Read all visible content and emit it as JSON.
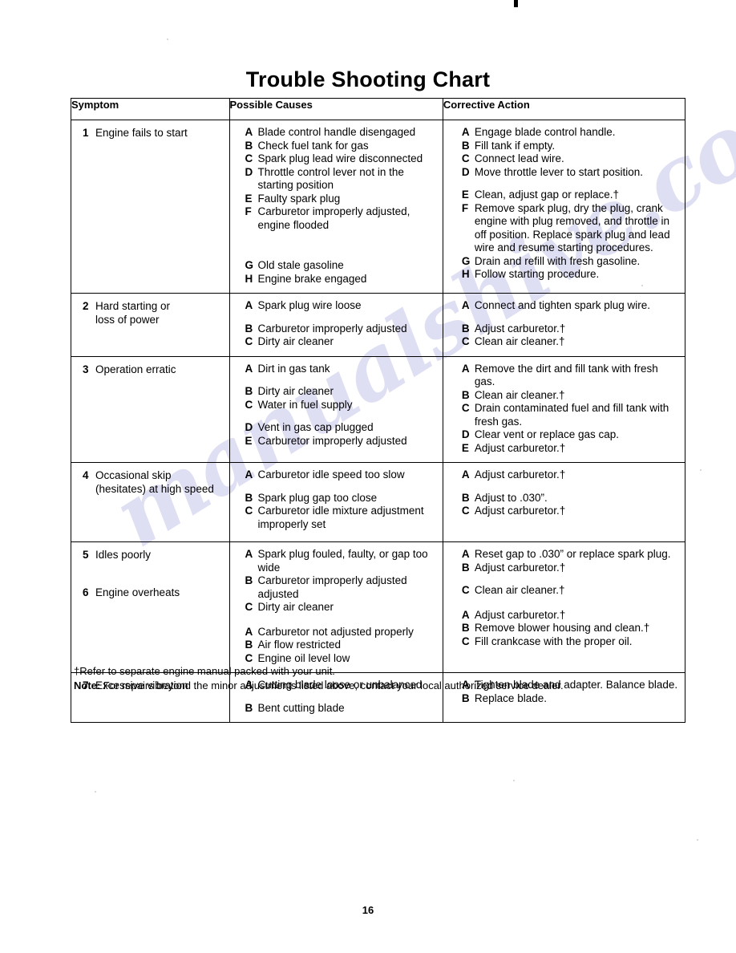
{
  "document": {
    "title": "Trouble Shooting Chart",
    "page_number": "16",
    "watermark": "manualshive.com"
  },
  "table": {
    "headers": {
      "symptom": "Symptom",
      "possible_causes": "Possible Causes",
      "corrective_action": "Corrective Action"
    },
    "rows": [
      {
        "number": "1",
        "symptom": "Engine fails to start",
        "symptom_line2": "",
        "causes": [
          {
            "letter": "A",
            "text": "Blade control handle disengaged"
          },
          {
            "letter": "B",
            "text": "Check fuel tank for gas"
          },
          {
            "letter": "C",
            "text": "Spark plug lead wire disconnected"
          },
          {
            "letter": "D",
            "text": "Throttle control lever not in the starting position"
          },
          {
            "letter": "E",
            "text": "Faulty spark plug"
          },
          {
            "letter": "F",
            "text": "Carburetor improperly adjusted, engine flooded"
          },
          {
            "letter": "G",
            "text": "Old stale gasoline"
          },
          {
            "letter": "H",
            "text": "Engine brake engaged"
          }
        ],
        "actions": [
          {
            "letter": "A",
            "text": "Engage blade control handle."
          },
          {
            "letter": "B",
            "text": "Fill tank if empty."
          },
          {
            "letter": "C",
            "text": "Connect lead wire."
          },
          {
            "letter": "D",
            "text": "Move throttle lever to start position."
          },
          {
            "letter": "E",
            "text": "Clean, adjust gap or replace.†"
          },
          {
            "letter": "F",
            "text": "Remove spark plug, dry the plug, crank engine with plug removed, and throttle in off position. Replace spark plug and lead wire and resume starting procedures."
          },
          {
            "letter": "G",
            "text": "Drain and refill with fresh gasoline."
          },
          {
            "letter": "H",
            "text": "Follow starting procedure."
          }
        ]
      },
      {
        "number": "2",
        "symptom": "Hard starting or",
        "symptom_line2": "loss of power",
        "causes": [
          {
            "letter": "A",
            "text": "Spark plug wire loose"
          },
          {
            "letter": "B",
            "text": "Carburetor improperly adjusted"
          },
          {
            "letter": "C",
            "text": "Dirty air cleaner"
          }
        ],
        "actions": [
          {
            "letter": "A",
            "text": "Connect and tighten spark plug wire."
          },
          {
            "letter": "B",
            "text": "Adjust carburetor.†"
          },
          {
            "letter": "C",
            "text": "Clean air cleaner.†"
          }
        ]
      },
      {
        "number": "3",
        "symptom": "Operation erratic",
        "symptom_line2": "",
        "causes": [
          {
            "letter": "A",
            "text": "Dirt in gas tank"
          },
          {
            "letter": "B",
            "text": "Dirty air cleaner"
          },
          {
            "letter": "C",
            "text": "Water in fuel supply"
          },
          {
            "letter": "D",
            "text": "Vent in gas cap plugged"
          },
          {
            "letter": "E",
            "text": "Carburetor improperly adjusted"
          }
        ],
        "actions": [
          {
            "letter": "A",
            "text": "Remove the dirt and fill tank with fresh gas."
          },
          {
            "letter": "B",
            "text": "Clean air cleaner.†"
          },
          {
            "letter": "C",
            "text": "Drain contaminated fuel and fill tank with fresh gas."
          },
          {
            "letter": "D",
            "text": "Clear vent or replace gas cap."
          },
          {
            "letter": "E",
            "text": "Adjust carburetor.†"
          }
        ]
      },
      {
        "number": "4",
        "symptom": "Occasional skip",
        "symptom_line2": "(hesitates) at high speed",
        "causes": [
          {
            "letter": "A",
            "text": "Carburetor idle speed too slow"
          },
          {
            "letter": "B",
            "text": "Spark plug gap too close"
          },
          {
            "letter": "C",
            "text": "Carburetor idle mixture adjustment improperly set"
          }
        ],
        "actions": [
          {
            "letter": "A",
            "text": "Adjust carburetor.†"
          },
          {
            "letter": "B",
            "text": "Adjust to .030”."
          },
          {
            "letter": "C",
            "text": "Adjust carburetor.†"
          }
        ]
      },
      {
        "number": "5",
        "symptom": "Idles poorly",
        "symptom_line2": "",
        "causes": [
          {
            "letter": "A",
            "text": "Spark plug fouled, faulty, or gap too wide"
          },
          {
            "letter": "B",
            "text": "Carburetor improperly adjusted adjusted"
          },
          {
            "letter": "C",
            "text": "Dirty air cleaner"
          }
        ],
        "actions": [
          {
            "letter": "A",
            "text": "Reset gap to .030” or replace spark plug."
          },
          {
            "letter": "B",
            "text": "Adjust carburetor.†"
          },
          {
            "letter": "C",
            "text": "Clean air cleaner.†"
          }
        ]
      },
      {
        "number": "6",
        "symptom": "Engine overheats",
        "symptom_line2": "",
        "causes": [
          {
            "letter": "A",
            "text": "Carburetor not adjusted properly"
          },
          {
            "letter": "B",
            "text": "Air flow restricted"
          },
          {
            "letter": "C",
            "text": "Engine oil level low"
          }
        ],
        "actions": [
          {
            "letter": "A",
            "text": "Adjust carburetor.†"
          },
          {
            "letter": "B",
            "text": "Remove blower housing and clean.†"
          },
          {
            "letter": "C",
            "text": "Fill crankcase with the proper oil."
          }
        ]
      },
      {
        "number": "7",
        "symptom": "Excessive vibration",
        "symptom_line2": "",
        "causes": [
          {
            "letter": "A",
            "text": "Cutting blade loose or unbalanced"
          },
          {
            "letter": "B",
            "text": "Bent cutting blade"
          }
        ],
        "actions": [
          {
            "letter": "A",
            "text": "Tighten blade and adapter. Balance blade."
          },
          {
            "letter": "B",
            "text": "Replace blade."
          }
        ]
      }
    ]
  },
  "footnotes": {
    "dagger": "†Refer to separate engine manual packed with your unit.",
    "note_label": "Note:",
    "note_text": " For repairs beyond the minor adjustments listed above, contact your local authorized service dealer."
  }
}
